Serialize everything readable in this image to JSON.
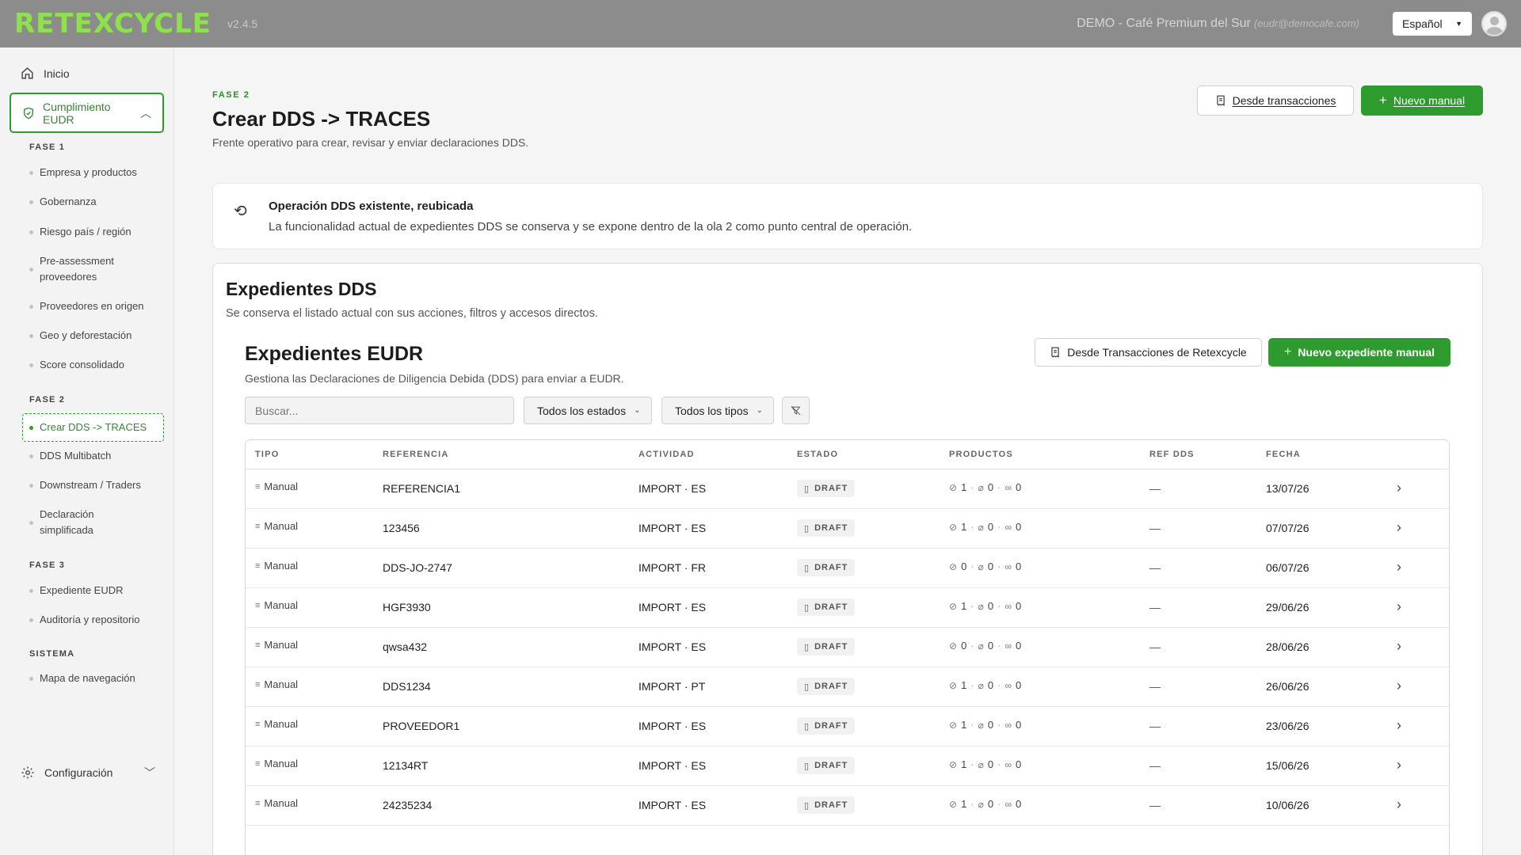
{
  "header": {
    "logo": "RETEXCYCLE",
    "version": "v2.4.5",
    "account": "DEMO - Café Premium del Sur",
    "email": "(eudr@democafe.com)",
    "language": "Español"
  },
  "sidebar": {
    "home": "Inicio",
    "eudr": "Cumplimiento EUDR",
    "phase1": "FASE 1",
    "phase1_items": [
      "Empresa y productos",
      "Gobernanza",
      "Riesgo país / región",
      "Pre-assessment proveedores",
      "Proveedores en origen",
      "Geo y deforestación",
      "Score consolidado"
    ],
    "phase2": "FASE 2",
    "phase2_items": [
      "Crear DDS -> TRACES",
      "DDS Multibatch",
      "Downstream / Traders",
      "Declaración simplificada"
    ],
    "phase3": "FASE 3",
    "phase3_items": [
      "Expediente EUDR",
      "Auditoría y repositorio"
    ],
    "system": "SISTEMA",
    "system_items": [
      "Mapa de navegación"
    ],
    "config": "Configuración"
  },
  "page": {
    "phase": "FASE 2",
    "title": "Crear DDS -> TRACES",
    "subtitle": "Frente operativo para crear, revisar y enviar declaraciones DDS.",
    "btn_from_tx": "Desde transacciones",
    "btn_new_manual": "Nuevo manual"
  },
  "notice": {
    "title": "Operación DDS existente, reubicada",
    "text": "La funcionalidad actual de expedientes DDS se conserva y se expone dentro de la ola 2 como punto central de operación."
  },
  "panel": {
    "title": "Expedientes DDS",
    "subtitle": "Se conserva el listado actual con sus acciones, filtros y accesos directos."
  },
  "section": {
    "title": "Expedientes EUDR",
    "subtitle": "Gestiona las Declaraciones de Diligencia Debida (DDS) para enviar a EUDR.",
    "btn_from_tx": "Desde Transacciones de Retexcycle",
    "btn_new": "Nuevo expediente manual",
    "search_placeholder": "Buscar...",
    "filter_state": "Todos los estados",
    "filter_type": "Todos los tipos"
  },
  "table": {
    "headers": [
      "TIPO",
      "REFERENCIA",
      "ACTIVIDAD",
      "ESTADO",
      "PRODUCTOS",
      "REF DDS",
      "FECHA"
    ],
    "rows": [
      {
        "tipo": "Manual",
        "ref": "REFERENCIA1",
        "act": "IMPORT · ES",
        "estado": "DRAFT",
        "p": "1",
        "a": "0",
        "l": "0",
        "refdds": "—",
        "fecha": "13/07/26"
      },
      {
        "tipo": "Manual",
        "ref": "123456",
        "act": "IMPORT · ES",
        "estado": "DRAFT",
        "p": "1",
        "a": "0",
        "l": "0",
        "refdds": "—",
        "fecha": "07/07/26"
      },
      {
        "tipo": "Manual",
        "ref": "DDS-JO-2747",
        "act": "IMPORT · FR",
        "estado": "DRAFT",
        "p": "0",
        "a": "0",
        "l": "0",
        "refdds": "—",
        "fecha": "06/07/26"
      },
      {
        "tipo": "Manual",
        "ref": "HGF3930",
        "act": "IMPORT · ES",
        "estado": "DRAFT",
        "p": "1",
        "a": "0",
        "l": "0",
        "refdds": "—",
        "fecha": "29/06/26"
      },
      {
        "tipo": "Manual",
        "ref": "qwsa432",
        "act": "IMPORT · ES",
        "estado": "DRAFT",
        "p": "0",
        "a": "0",
        "l": "0",
        "refdds": "—",
        "fecha": "28/06/26"
      },
      {
        "tipo": "Manual",
        "ref": "DDS1234",
        "act": "IMPORT · PT",
        "estado": "DRAFT",
        "p": "1",
        "a": "0",
        "l": "0",
        "refdds": "—",
        "fecha": "26/06/26"
      },
      {
        "tipo": "Manual",
        "ref": "PROVEEDOR1",
        "act": "IMPORT · ES",
        "estado": "DRAFT",
        "p": "1",
        "a": "0",
        "l": "0",
        "refdds": "—",
        "fecha": "23/06/26"
      },
      {
        "tipo": "Manual",
        "ref": "12134RT",
        "act": "IMPORT · ES",
        "estado": "DRAFT",
        "p": "1",
        "a": "0",
        "l": "0",
        "refdds": "—",
        "fecha": "15/06/26"
      },
      {
        "tipo": "Manual",
        "ref": "24235234",
        "act": "IMPORT · ES",
        "estado": "DRAFT",
        "p": "1",
        "a": "0",
        "l": "0",
        "refdds": "—",
        "fecha": "10/06/26"
      }
    ]
  },
  "colors": {
    "brand_green": "#2e9b2e",
    "logo_green": "#8fe04f",
    "topbar": "#8c8c8c"
  }
}
